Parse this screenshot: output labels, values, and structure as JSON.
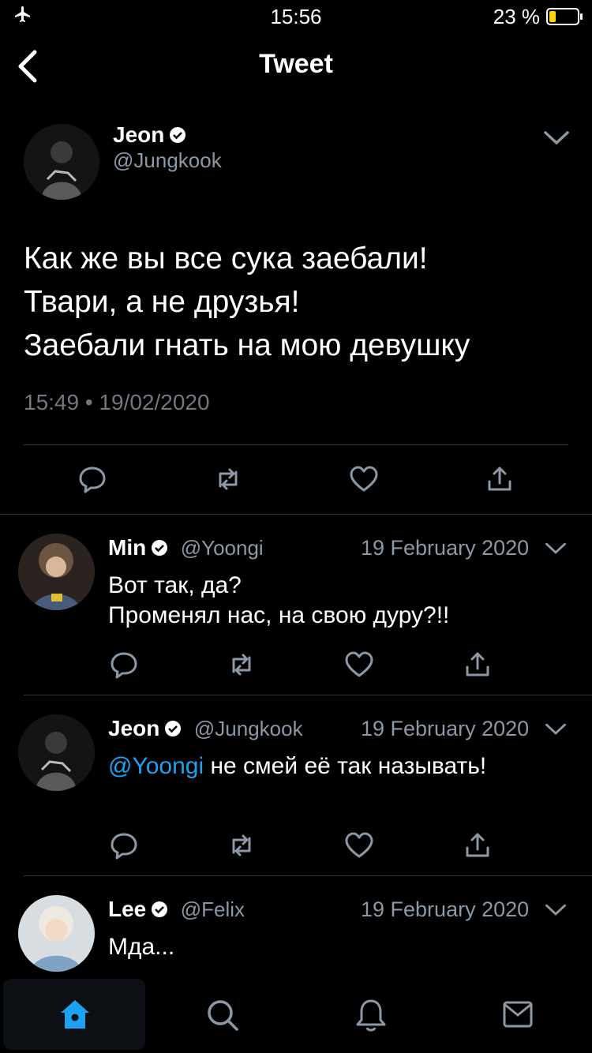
{
  "status": {
    "time": "15:56",
    "battery": "23 %",
    "battery_level": 0.23
  },
  "header": {
    "title": "Tweet"
  },
  "main_tweet": {
    "name": "Jeon",
    "handle": "@Jungkook",
    "text": "Как же вы все сука заебали!\nТвари, а не друзья!\nЗаебали гнать на мою девушку",
    "timestamp": "15:49 • 19/02/2020"
  },
  "replies": [
    {
      "name": "Min",
      "handle": "@Yoongi",
      "date": "19 February 2020",
      "text": "Вот так, да?\nПроменял нас, на свою дуру?!!"
    },
    {
      "name": "Jeon",
      "handle": "@Jungkook",
      "date": "19 February 2020",
      "mention": "@Yoongi",
      "text": " не смей её так называть!"
    },
    {
      "name": "Lee",
      "handle": "@Felix",
      "date": "19 February 2020",
      "text": "Мда..."
    }
  ],
  "icons": {
    "reply": "speech-bubble-icon",
    "retweet": "retweet-icon",
    "like": "heart-icon",
    "share": "share-icon"
  },
  "colors": {
    "accent": "#1da1f2",
    "muted": "#8b98a5",
    "background": "#000000"
  }
}
